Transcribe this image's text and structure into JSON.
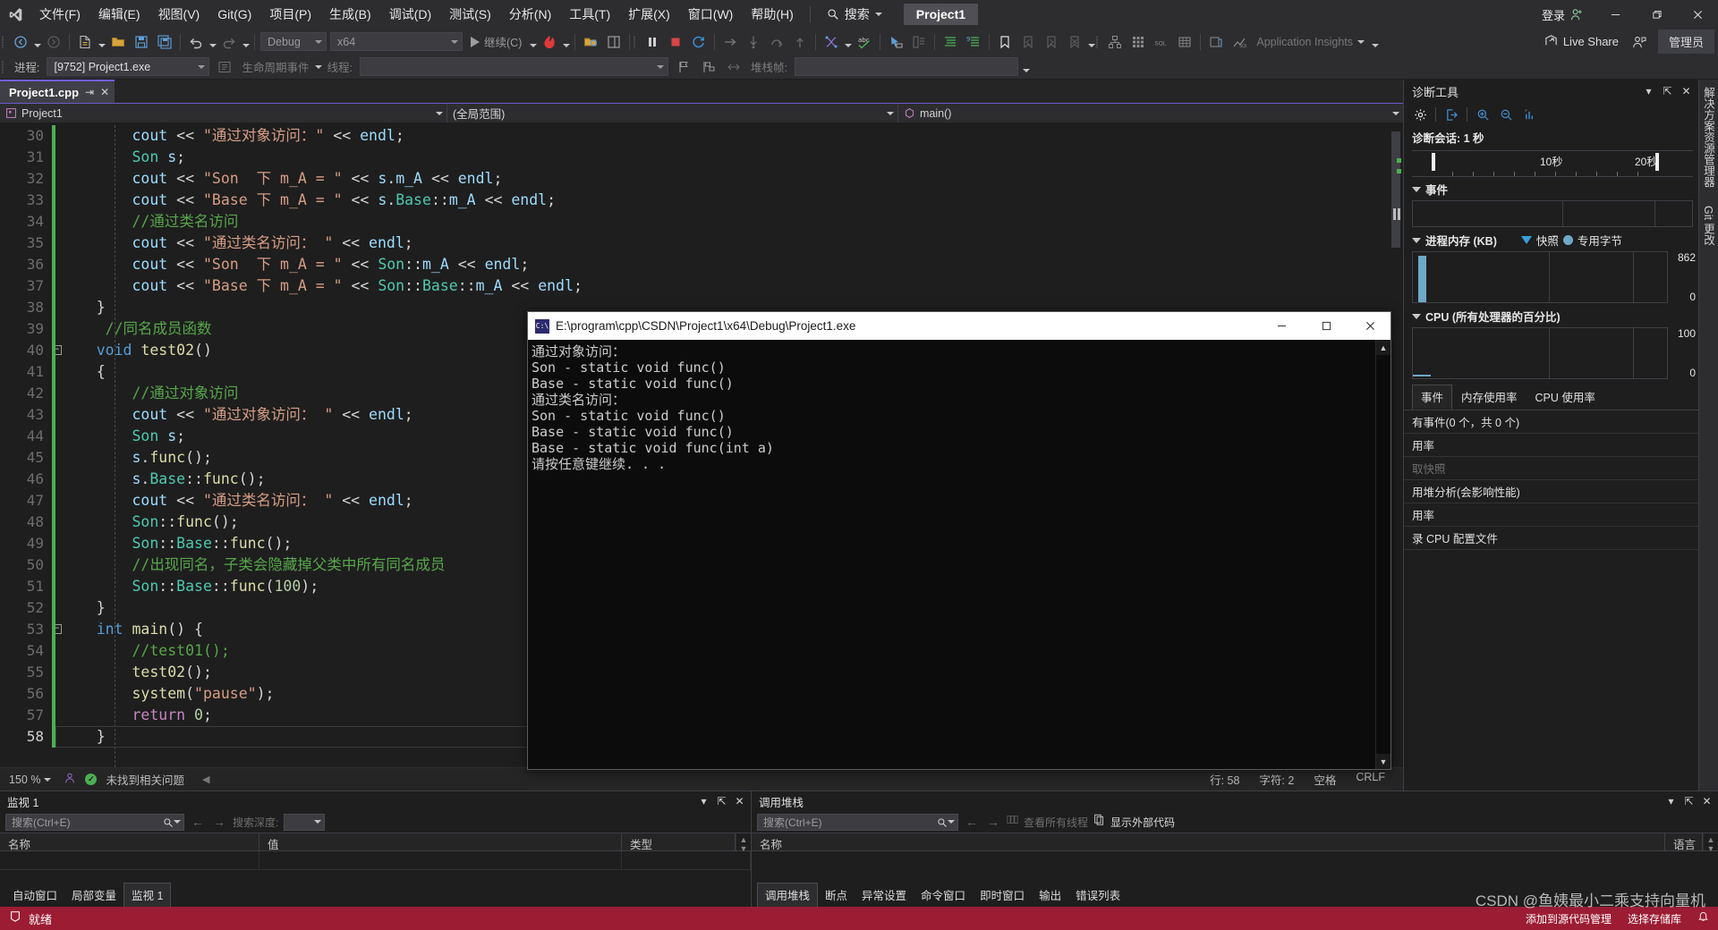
{
  "app": {
    "title": "Project1",
    "signin_label": "登录",
    "live_share_label": "Live Share",
    "admin_label": "管理员",
    "search_placeholder": "搜索"
  },
  "menu": {
    "items": [
      {
        "label": "文件(F)",
        "name": "menu-file"
      },
      {
        "label": "编辑(E)",
        "name": "menu-edit"
      },
      {
        "label": "视图(V)",
        "name": "menu-view"
      },
      {
        "label": "Git(G)",
        "name": "menu-git"
      },
      {
        "label": "项目(P)",
        "name": "menu-project"
      },
      {
        "label": "生成(B)",
        "name": "menu-build"
      },
      {
        "label": "调试(D)",
        "name": "menu-debug"
      },
      {
        "label": "测试(S)",
        "name": "menu-test"
      },
      {
        "label": "分析(N)",
        "name": "menu-analyze"
      },
      {
        "label": "工具(T)",
        "name": "menu-tools"
      },
      {
        "label": "扩展(X)",
        "name": "menu-extensions"
      },
      {
        "label": "窗口(W)",
        "name": "menu-window"
      },
      {
        "label": "帮助(H)",
        "name": "menu-help"
      }
    ]
  },
  "toolbar": {
    "config": "Debug",
    "platform": "x64",
    "continue_label": "继续(C)",
    "app_insights": "Application Insights"
  },
  "procbar": {
    "process_label": "进程:",
    "process_value": "[9752] Project1.exe",
    "lifecycle_label": "生命周期事件",
    "thread_label": "线程:",
    "thread_value": "",
    "stackframe_label": "堆栈帧:",
    "stackframe_value": ""
  },
  "editor": {
    "tab_name": "Project1.cpp",
    "nav_project": "Project1",
    "nav_scope": "(全局范围)",
    "nav_member": "main()",
    "first_line": 30,
    "current_line": 58,
    "lines": [
      {
        "n": 30,
        "html": "        <span class='var'>cout</span> <span class='op'>&lt;&lt;</span> <span class='str'>\"通过对象访问：\"</span> <span class='op'>&lt;&lt;</span> <span class='var'>endl</span><span class='op'>;</span>"
      },
      {
        "n": 31,
        "html": "        <span class='type'>Son</span> <span class='var'>s</span><span class='op'>;</span>"
      },
      {
        "n": 32,
        "html": "        <span class='var'>cout</span> <span class='op'>&lt;&lt;</span> <span class='str'>\"Son  下 m_A = \"</span> <span class='op'>&lt;&lt;</span> <span class='var'>s</span><span class='op'>.</span><span class='var'>m_A</span> <span class='op'>&lt;&lt;</span> <span class='var'>endl</span><span class='op'>;</span>"
      },
      {
        "n": 33,
        "html": "        <span class='var'>cout</span> <span class='op'>&lt;&lt;</span> <span class='str'>\"Base 下 m_A = \"</span> <span class='op'>&lt;&lt;</span> <span class='var'>s</span><span class='op'>.</span><span class='type'>Base</span><span class='op'>::</span><span class='var'>m_A</span> <span class='op'>&lt;&lt;</span> <span class='var'>endl</span><span class='op'>;</span>"
      },
      {
        "n": 34,
        "html": "        <span class='cmt'>//通过类名访问</span>"
      },
      {
        "n": 35,
        "html": "        <span class='var'>cout</span> <span class='op'>&lt;&lt;</span> <span class='str'>\"通过类名访问： \"</span> <span class='op'>&lt;&lt;</span> <span class='var'>endl</span><span class='op'>;</span>"
      },
      {
        "n": 36,
        "html": "        <span class='var'>cout</span> <span class='op'>&lt;&lt;</span> <span class='str'>\"Son  下 m_A = \"</span> <span class='op'>&lt;&lt;</span> <span class='type'>Son</span><span class='op'>::</span><span class='var'>m_A</span> <span class='op'>&lt;&lt;</span> <span class='var'>endl</span><span class='op'>;</span>"
      },
      {
        "n": 37,
        "html": "        <span class='var'>cout</span> <span class='op'>&lt;&lt;</span> <span class='str'>\"Base 下 m_A = \"</span> <span class='op'>&lt;&lt;</span> <span class='type'>Son</span><span class='op'>::</span><span class='type'>Base</span><span class='op'>::</span><span class='var'>m_A</span> <span class='op'>&lt;&lt;</span> <span class='var'>endl</span><span class='op'>;</span>"
      },
      {
        "n": 38,
        "html": "    <span class='op'>}</span>"
      },
      {
        "n": 39,
        "html": "     <span class='cmt'>//同名成员函数</span>"
      },
      {
        "n": 40,
        "html": "    <span class='kw'>void</span> <span class='fn'>test02</span><span class='op'>()</span>"
      },
      {
        "n": 41,
        "html": "    <span class='op'>{</span>"
      },
      {
        "n": 42,
        "html": "        <span class='cmt'>//通过对象访问</span>"
      },
      {
        "n": 43,
        "html": "        <span class='var'>cout</span> <span class='op'>&lt;&lt;</span> <span class='str'>\"通过对象访问： \"</span> <span class='op'>&lt;&lt;</span> <span class='var'>endl</span><span class='op'>;</span>"
      },
      {
        "n": 44,
        "html": "        <span class='type'>Son</span> <span class='var'>s</span><span class='op'>;</span>"
      },
      {
        "n": 45,
        "html": "        <span class='var'>s</span><span class='op'>.</span><span class='fn'>func</span><span class='op'>();</span>"
      },
      {
        "n": 46,
        "html": "        <span class='var'>s</span><span class='op'>.</span><span class='type'>Base</span><span class='op'>::</span><span class='fn'>func</span><span class='op'>();</span>"
      },
      {
        "n": 47,
        "html": "        <span class='var'>cout</span> <span class='op'>&lt;&lt;</span> <span class='str'>\"通过类名访问： \"</span> <span class='op'>&lt;&lt;</span> <span class='var'>endl</span><span class='op'>;</span>"
      },
      {
        "n": 48,
        "html": "        <span class='type'>Son</span><span class='op'>::</span><span class='fn'>func</span><span class='op'>();</span>"
      },
      {
        "n": 49,
        "html": "        <span class='type'>Son</span><span class='op'>::</span><span class='type'>Base</span><span class='op'>::</span><span class='fn'>func</span><span class='op'>();</span>"
      },
      {
        "n": 50,
        "html": "        <span class='cmt'>//出现同名，子类会隐藏掉父类中所有同名成员</span>"
      },
      {
        "n": 51,
        "html": "        <span class='type'>Son</span><span class='op'>::</span><span class='type'>Base</span><span class='op'>::</span><span class='fn'>func</span><span class='op'>(</span><span class='num'>100</span><span class='op'>);</span>"
      },
      {
        "n": 52,
        "html": "    <span class='op'>}</span>"
      },
      {
        "n": 53,
        "html": "    <span class='kw'>int</span> <span class='fn'>main</span><span class='op'>() {</span>"
      },
      {
        "n": 54,
        "html": "        <span class='cmt'>//test01();</span>"
      },
      {
        "n": 55,
        "html": "        <span class='fn'>test02</span><span class='op'>();</span>"
      },
      {
        "n": 56,
        "html": "        <span class='fn'>system</span><span class='op'>(</span><span class='str'>\"pause\"</span><span class='op'>);</span>"
      },
      {
        "n": 57,
        "html": "        <span class='kw2'>return</span> <span class='num'>0</span><span class='op'>;</span>"
      },
      {
        "n": 58,
        "html": "    <span class='op'>}</span>"
      }
    ],
    "status": {
      "zoom": "150 %",
      "issues": "未找到相关问题",
      "line": "行: 58",
      "col": "字符: 2",
      "spaces": "空格",
      "eol": "CRLF"
    }
  },
  "console": {
    "title": "E:\\program\\cpp\\CSDN\\Project1\\x64\\Debug\\Project1.exe",
    "icon": "console-app-icon",
    "output": "通过对象访问：\nSon - static void func()\nBase - static void func()\n通过类名访问：\nSon - static void func()\nBase - static void func()\nBase - static void func(int a)\n请按任意键继续. . ."
  },
  "diagnostics": {
    "title": "诊断工具",
    "session": "诊断会话: 1 秒",
    "ruler": {
      "t10": "10秒",
      "t20": "20秒"
    },
    "events_header": "事件",
    "memory_header": "进程内存 (KB)",
    "memory_legend_snapshot": "快照",
    "memory_legend_private": "专用字节",
    "memory_max": "862",
    "memory_min": "0",
    "cpu_header": "CPU (所有处理器的百分比)",
    "cpu_max": "100",
    "cpu_min": "0",
    "tabs": [
      "事件",
      "内存使用率",
      "CPU 使用率"
    ],
    "active_tab": "事件",
    "rows": [
      {
        "label": "有事件(0 个，共 0 个)",
        "dim": false
      },
      {
        "label": "用率",
        "dim": false
      },
      {
        "label": "取快照",
        "dim": true
      },
      {
        "label": "用堆分析(会影响性能)",
        "dim": false
      },
      {
        "label": "用率",
        "dim": false
      },
      {
        "label": "录 CPU 配置文件",
        "dim": false
      }
    ],
    "vstrip": [
      "解决方案资源管理器",
      "Git 更改"
    ]
  },
  "watch": {
    "title": "监视 1",
    "search_placeholder": "搜索(Ctrl+E)",
    "depth_label": "搜索深度:",
    "depth_value": "",
    "columns": [
      "名称",
      "值",
      "类型"
    ],
    "tabs": [
      "自动窗口",
      "局部变量",
      "监视 1"
    ],
    "active_tab": "监视 1"
  },
  "callstack": {
    "title": "调用堆栈",
    "search_placeholder": "搜索(Ctrl+E)",
    "view_all_threads": "查看所有线程",
    "show_external_code": "显示外部代码",
    "columns": [
      "名称",
      "语言"
    ],
    "tabs": [
      "调用堆栈",
      "断点",
      "异常设置",
      "命令窗口",
      "即时窗口",
      "输出",
      "错误列表"
    ],
    "active_tab": "调用堆栈"
  },
  "statusbar": {
    "text": "就绪",
    "add_to_source_control": "添加到源代码管理",
    "select_repo": "选择存储库"
  },
  "watermark": "CSDN @鱼姨最小二乘支持向量机"
}
